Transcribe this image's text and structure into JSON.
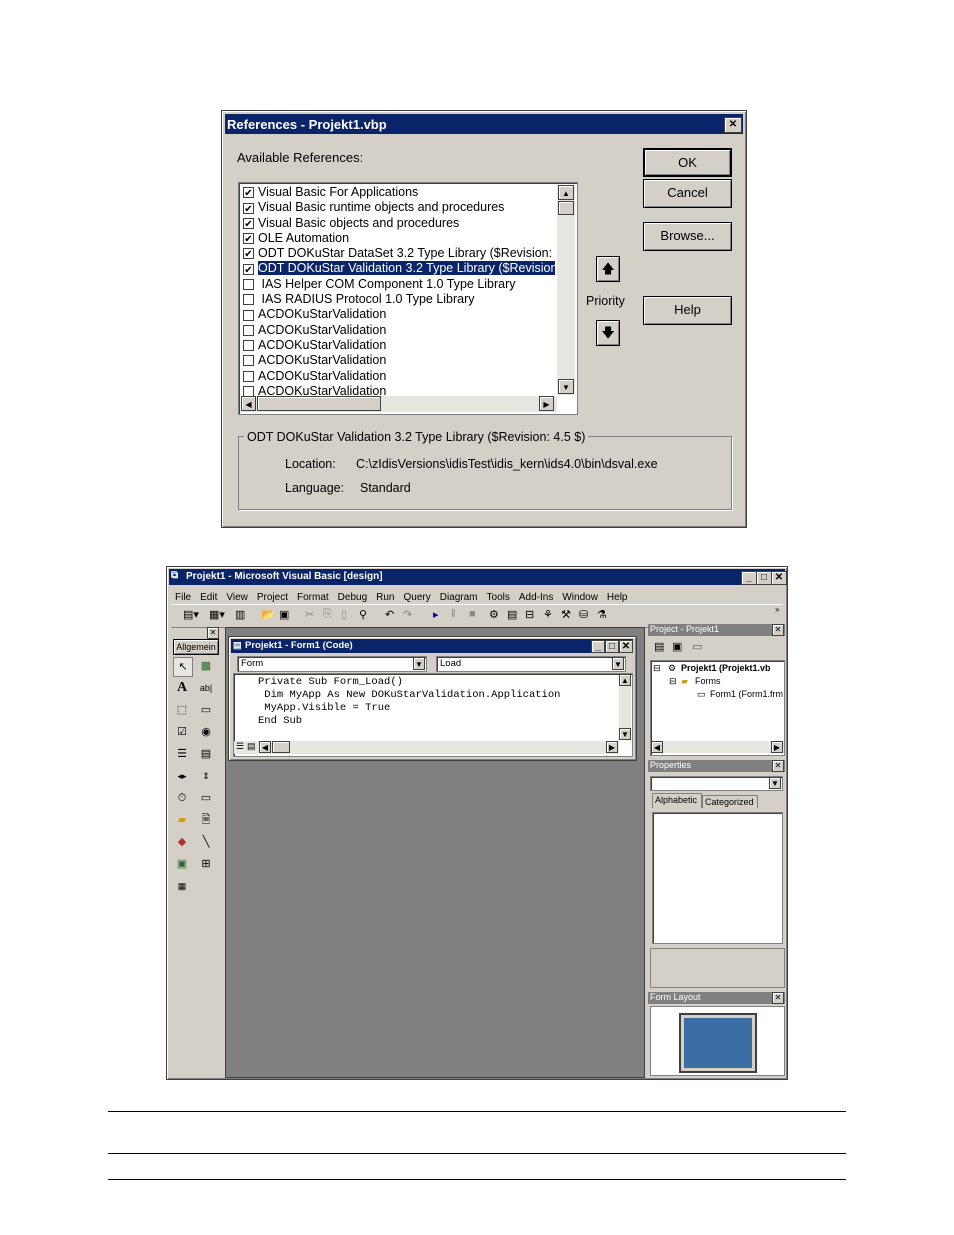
{
  "references_dialog": {
    "title": "References - Projekt1.vbp",
    "close_glyph": "✕",
    "available_label": "Available References:",
    "buttons": {
      "ok": "OK",
      "cancel": "Cancel",
      "browse": "Browse...",
      "help": "Help"
    },
    "priority_label": "Priority",
    "references": [
      {
        "label": "Visual Basic For Applications",
        "checked": true,
        "selected": false
      },
      {
        "label": "Visual Basic runtime objects and procedures",
        "checked": true,
        "selected": false
      },
      {
        "label": "Visual Basic objects and procedures",
        "checked": true,
        "selected": false
      },
      {
        "label": "OLE Automation",
        "checked": true,
        "selected": false
      },
      {
        "label": "ODT DOKuStar DataSet 3.2 Type Library ($Revision:",
        "checked": true,
        "selected": false
      },
      {
        "label": "ODT DOKuStar Validation 3.2 Type Library ($Revision",
        "checked": true,
        "selected": true
      },
      {
        "label": " IAS Helper COM Component 1.0 Type Library",
        "checked": false,
        "selected": false
      },
      {
        "label": " IAS RADIUS Protocol 1.0 Type Library",
        "checked": false,
        "selected": false
      },
      {
        "label": "ACDOKuStarValidation",
        "checked": false,
        "selected": false
      },
      {
        "label": "ACDOKuStarValidation",
        "checked": false,
        "selected": false
      },
      {
        "label": "ACDOKuStarValidation",
        "checked": false,
        "selected": false
      },
      {
        "label": "ACDOKuStarValidation",
        "checked": false,
        "selected": false
      },
      {
        "label": "ACDOKuStarValidation",
        "checked": false,
        "selected": false
      },
      {
        "label": "ACDOKuStarValidation",
        "checked": false,
        "selected": false
      }
    ],
    "details": {
      "group_title": "ODT DOKuStar Validation 3.2 Type Library ($Revision: 4.5 $)",
      "location_label": "Location:",
      "location_value": "C:\\zIdisVersions\\idisTest\\idis_kern\\ids4.0\\bin\\dsval.exe",
      "language_label": "Language:",
      "language_value": "Standard"
    }
  },
  "vb_ide": {
    "title": "Projekt1 - Microsoft Visual Basic [design]",
    "menu": [
      "File",
      "Edit",
      "View",
      "Project",
      "Format",
      "Debug",
      "Run",
      "Query",
      "Diagram",
      "Tools",
      "Add-Ins",
      "Window",
      "Help"
    ],
    "toolbox_tab": "Allgemein",
    "code_window": {
      "title": "Projekt1 - Form1 (Code)",
      "object_combo": "Form",
      "proc_combo": "Load",
      "lines": [
        "Private Sub Form_Load()",
        " Dim MyApp As New DOKuStarValidation.Application",
        " MyApp.Visible = True",
        "End Sub"
      ]
    },
    "project_panel": {
      "title": "Project - Projekt1",
      "tree": [
        "Projekt1 (Projekt1.vb",
        "Forms",
        "Form1 (Form1.frm"
      ]
    },
    "properties_panel": {
      "title": "Properties",
      "tabs": [
        "Alphabetic",
        "Categorized"
      ]
    },
    "form_layout_panel": {
      "title": "Form Layout"
    }
  },
  "colors": {
    "titlebar": "#0a246a",
    "face": "#d4d0c8",
    "mdi": "#808080",
    "form_preview": "#3a6ea5"
  }
}
